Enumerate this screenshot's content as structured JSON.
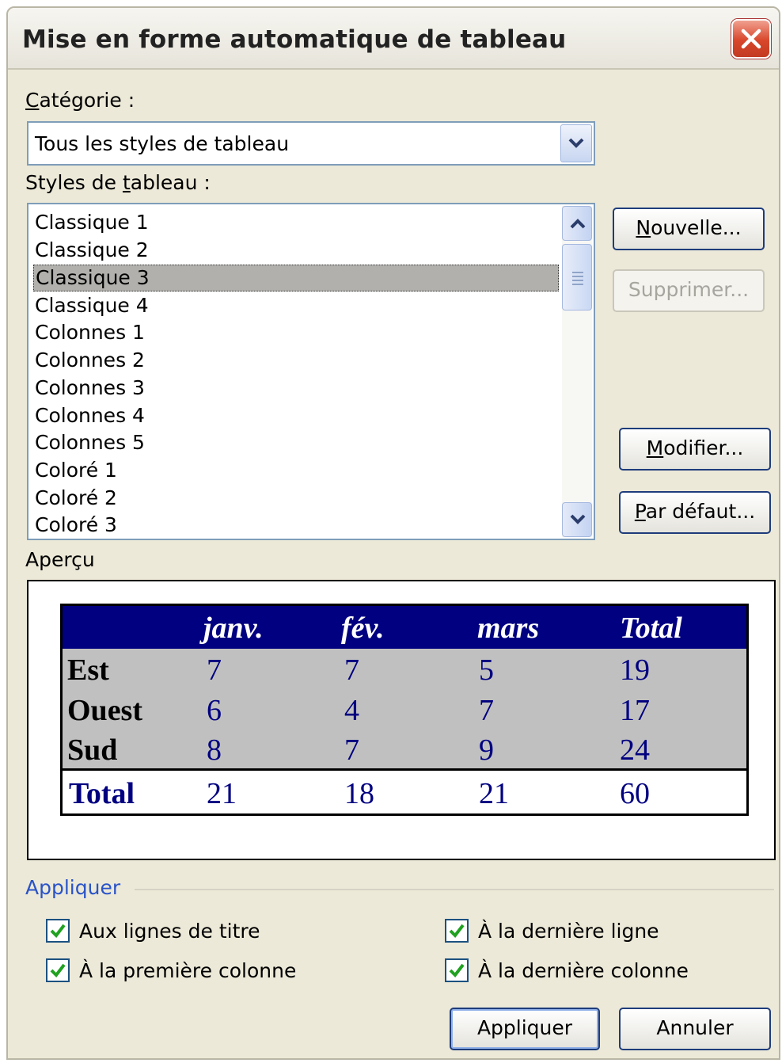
{
  "window": {
    "title": "Mise en forme automatique de tableau"
  },
  "category": {
    "label_pre": "",
    "label_ul": "C",
    "label_post": "atégorie :",
    "value": "Tous les styles de tableau"
  },
  "styles": {
    "label_pre": "Styles de ",
    "label_ul": "t",
    "label_post": "ableau :",
    "items": [
      "Classique 1",
      "Classique 2",
      "Classique 3",
      "Classique 4",
      "Colonnes 1",
      "Colonnes 2",
      "Colonnes 3",
      "Colonnes 4",
      "Colonnes 5",
      "Coloré 1",
      "Coloré 2",
      "Coloré 3"
    ],
    "selected": "Classique 3"
  },
  "buttons": {
    "new": {
      "ul": "N",
      "rest": "ouvelle..."
    },
    "delete": {
      "label": "Supprimer..."
    },
    "modify": {
      "ul": "M",
      "rest": "odifier..."
    },
    "default": {
      "ul": "P",
      "rest": "ar défaut..."
    },
    "apply": {
      "label": "Appliquer"
    },
    "cancel": {
      "label": "Annuler"
    }
  },
  "preview": {
    "label": "Aperçu",
    "headers": [
      "",
      "janv.",
      "fév.",
      "mars",
      "Total"
    ],
    "rows": [
      {
        "name": "Est",
        "values": [
          "7",
          "7",
          "5",
          "19"
        ]
      },
      {
        "name": "Ouest",
        "values": [
          "6",
          "4",
          "7",
          "17"
        ]
      },
      {
        "name": "Sud",
        "values": [
          "8",
          "7",
          "9",
          "24"
        ]
      }
    ],
    "total": {
      "name": "Total",
      "values": [
        "21",
        "18",
        "21",
        "60"
      ]
    }
  },
  "apply_group": {
    "label": "Appliquer",
    "options": [
      {
        "text": "Aux lignes de titre",
        "checked": true
      },
      {
        "text": "À la première colonne",
        "checked": true
      },
      {
        "text": "À la dernière ligne",
        "checked": true
      },
      {
        "text": "À la dernière colonne",
        "checked": true
      }
    ]
  }
}
